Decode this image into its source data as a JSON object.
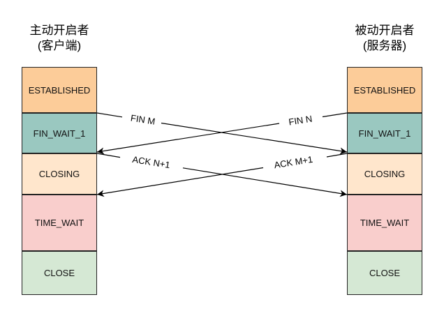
{
  "left_party": {
    "title": "主动开启者",
    "subtitle": "(客户端)",
    "states": [
      {
        "label": "ESTABLISHED",
        "color": "#fccc99"
      },
      {
        "label": "FIN_WAIT_1",
        "color": "#9ac8c0"
      },
      {
        "label": "CLOSING",
        "color": "#ffe6cc"
      },
      {
        "label": "TIME_WAIT",
        "color": "#f9cecc"
      },
      {
        "label": "CLOSE",
        "color": "#d5e8d4"
      }
    ]
  },
  "right_party": {
    "title": "被动开启者",
    "subtitle": "(服务器)",
    "states": [
      {
        "label": "ESTABLISHED",
        "color": "#fccc99"
      },
      {
        "label": "FIN_WAIT_1",
        "color": "#9ac8c0"
      },
      {
        "label": "CLOSING",
        "color": "#ffe6cc"
      },
      {
        "label": "TIME_WAIT",
        "color": "#f9cecc"
      },
      {
        "label": "CLOSE",
        "color": "#d5e8d4"
      }
    ]
  },
  "messages": [
    {
      "label": "FIN M"
    },
    {
      "label": "FIN N"
    },
    {
      "label": "ACK N+1"
    },
    {
      "label": "ACK M+1"
    }
  ]
}
